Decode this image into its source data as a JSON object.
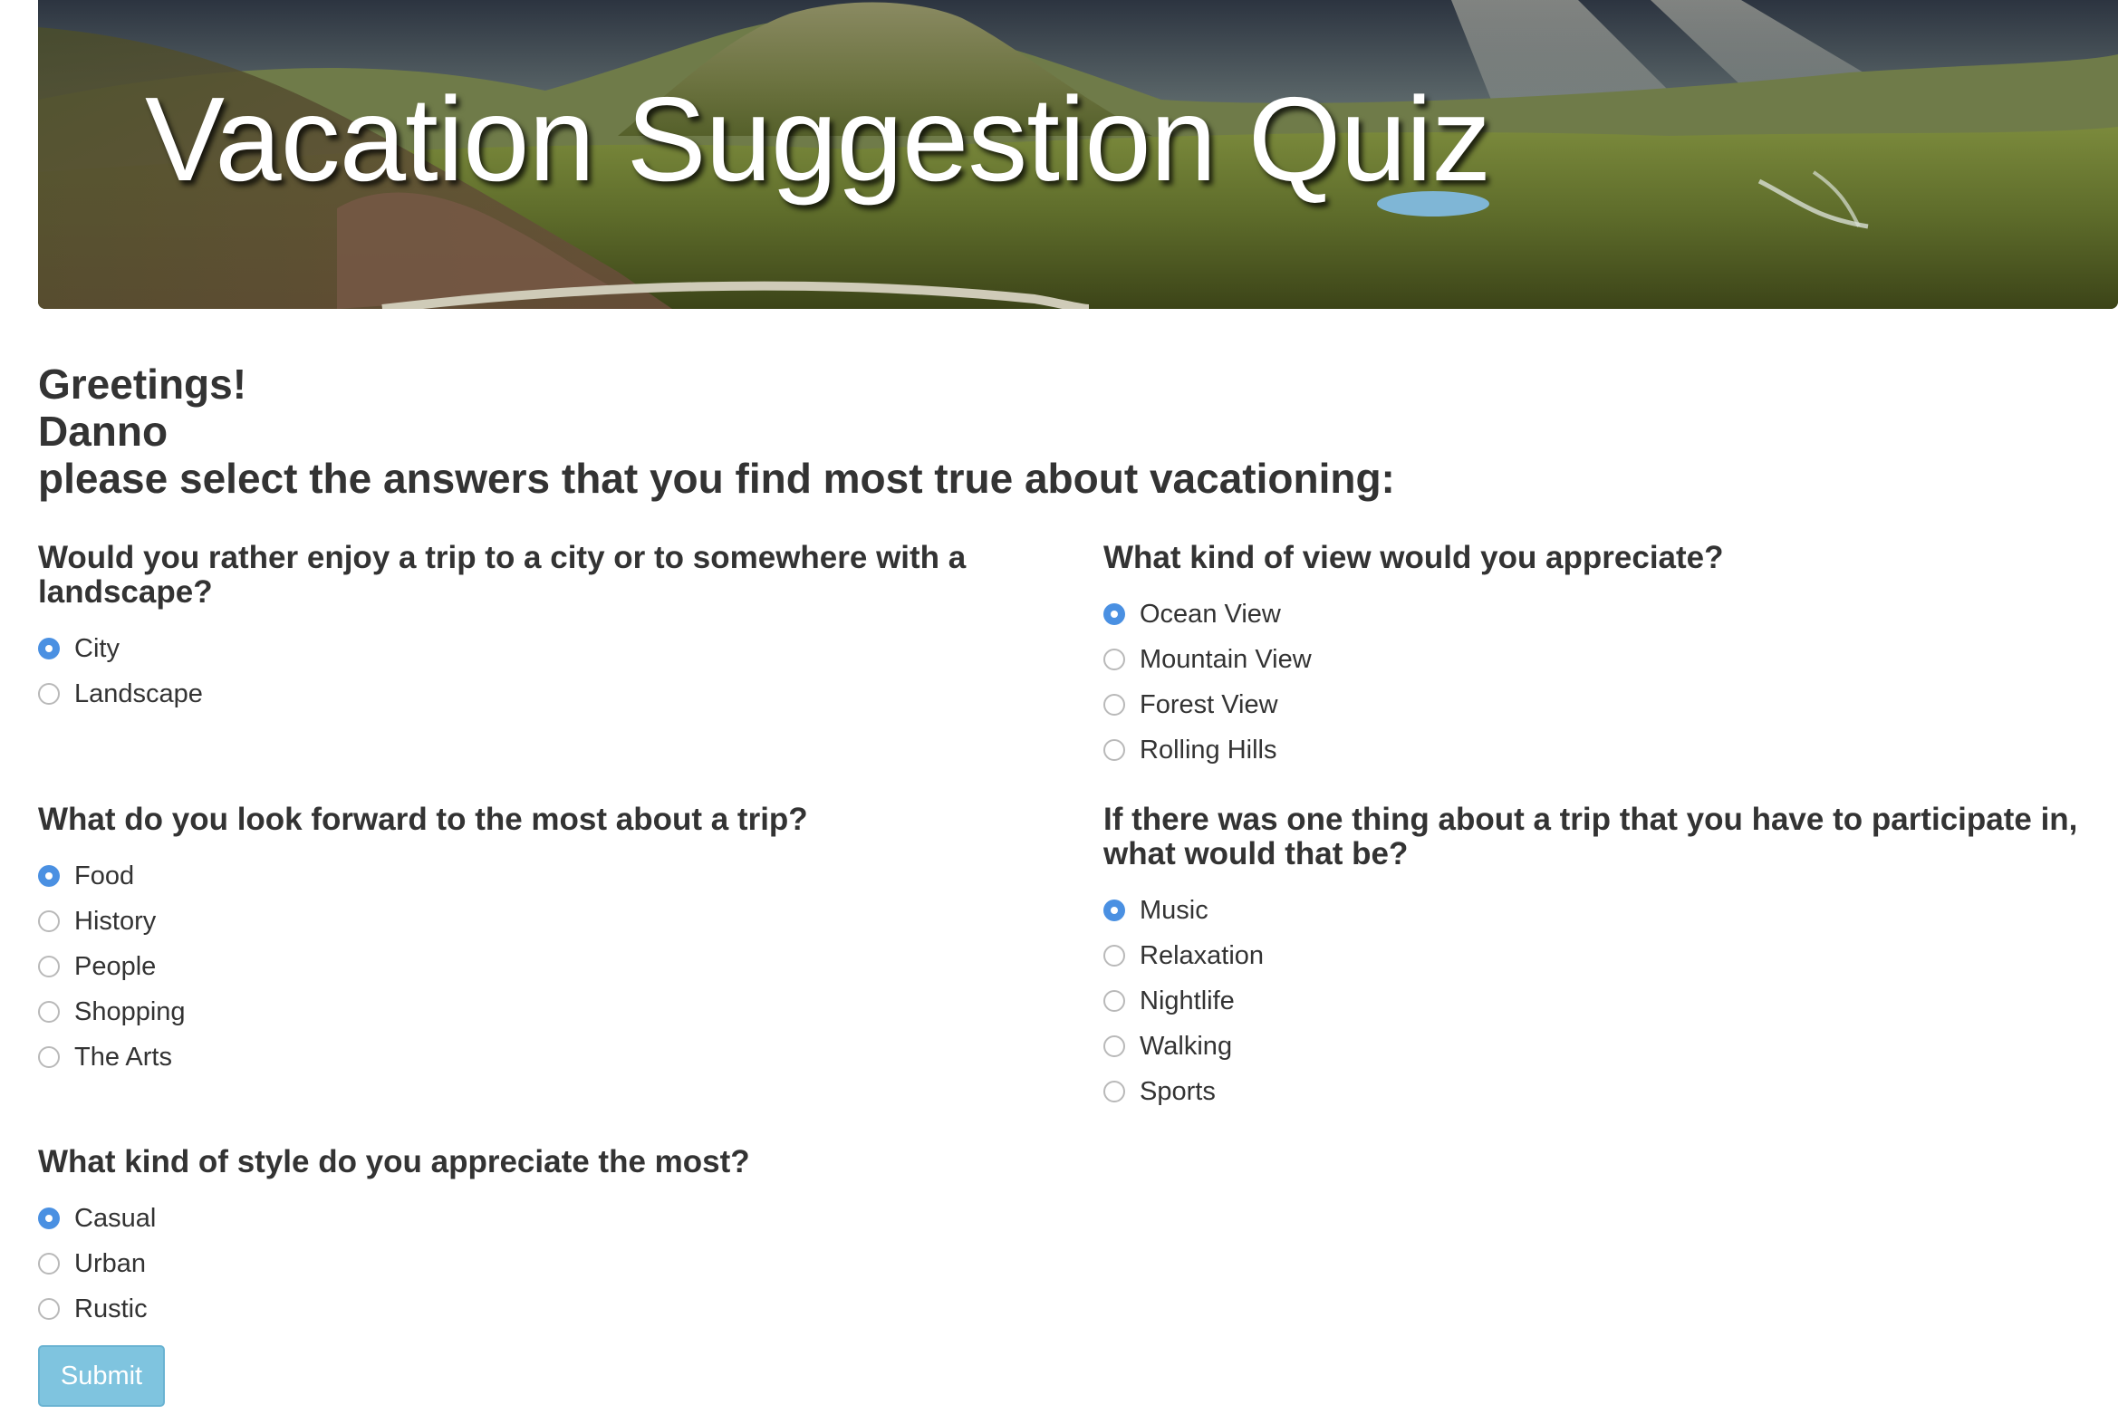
{
  "banner": {
    "title": "Vacation Suggestion Quiz"
  },
  "greeting": {
    "line1": "Greetings!",
    "line2": "Danno",
    "line3": "please select the answers that you find most true about vacationing:"
  },
  "questions": [
    {
      "title": "Would you rather enjoy a trip to a city or to somewhere with a landscape?",
      "options": [
        "City",
        "Landscape"
      ],
      "selected": "City"
    },
    {
      "title": "What kind of view would you appreciate?",
      "options": [
        "Ocean View",
        "Mountain View",
        "Forest View",
        "Rolling Hills"
      ],
      "selected": "Ocean View"
    },
    {
      "title": "What do you look forward to the most about a trip?",
      "options": [
        "Food",
        "History",
        "People",
        "Shopping",
        "The Arts"
      ],
      "selected": "Food"
    },
    {
      "title": "If there was one thing about a trip that you have to participate in, what would that be?",
      "options": [
        "Music",
        "Relaxation",
        "Nightlife",
        "Walking",
        "Sports"
      ],
      "selected": "Music"
    },
    {
      "title": "What kind of style do you appreciate the most?",
      "options": [
        "Casual",
        "Urban",
        "Rustic"
      ],
      "selected": "Casual"
    }
  ],
  "submit": {
    "label": "Submit"
  },
  "colors": {
    "accent": "#4a90e2",
    "button": "#7fc4df",
    "text": "#333333"
  }
}
